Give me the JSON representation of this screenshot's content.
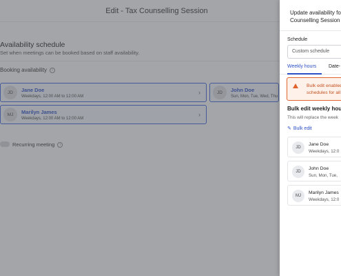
{
  "page": {
    "title": "Edit - Tax Counselling Session",
    "section_title": "Availability schedule",
    "section_subtitle": "Set when meetings can be booked based on staff availability.",
    "booking_label": "Booking availability",
    "recurring_label": "Recurring meeting",
    "staff": [
      {
        "initials": "JD",
        "name": "Jane Doe",
        "hours": "Weekdays, 12:00 AM to 12:00 AM"
      },
      {
        "initials": "JD",
        "name": "John Doe",
        "hours": "Sun, Mon, Tue, Wed, Thu"
      },
      {
        "initials": "MJ",
        "name": "Marilyn James",
        "hours": "Weekdays, 12:00 AM to 12:00 AM"
      }
    ]
  },
  "drawer": {
    "title_line1": "Update availability for",
    "title_line2": "Counselling Session",
    "schedule_label": "Schedule",
    "schedule_value": "Custom schedule",
    "tabs": [
      "Weekly hours",
      "Date-"
    ],
    "alert_line1": "Bulk edit enabled.",
    "alert_line2": "schedules for all s",
    "bulk_title": "Bulk edit weekly hours",
    "bulk_subtitle": "This will replace the week",
    "bulk_edit_link": "Bulk edit",
    "staff": [
      {
        "initials": "JD",
        "name": "Jane Doe",
        "hours": "Weekdays, 12:0"
      },
      {
        "initials": "JD",
        "name": "John Doe",
        "hours": "Sun, Mon, Tue,"
      },
      {
        "initials": "MJ",
        "name": "Marilyn James",
        "hours": "Weekdays, 12:0"
      }
    ]
  },
  "colors": {
    "accent": "#2b4fc7",
    "warning": "#e0622d"
  },
  "icons": [
    "info-icon",
    "chevron-right-icon",
    "warning-icon",
    "pencil-icon"
  ]
}
